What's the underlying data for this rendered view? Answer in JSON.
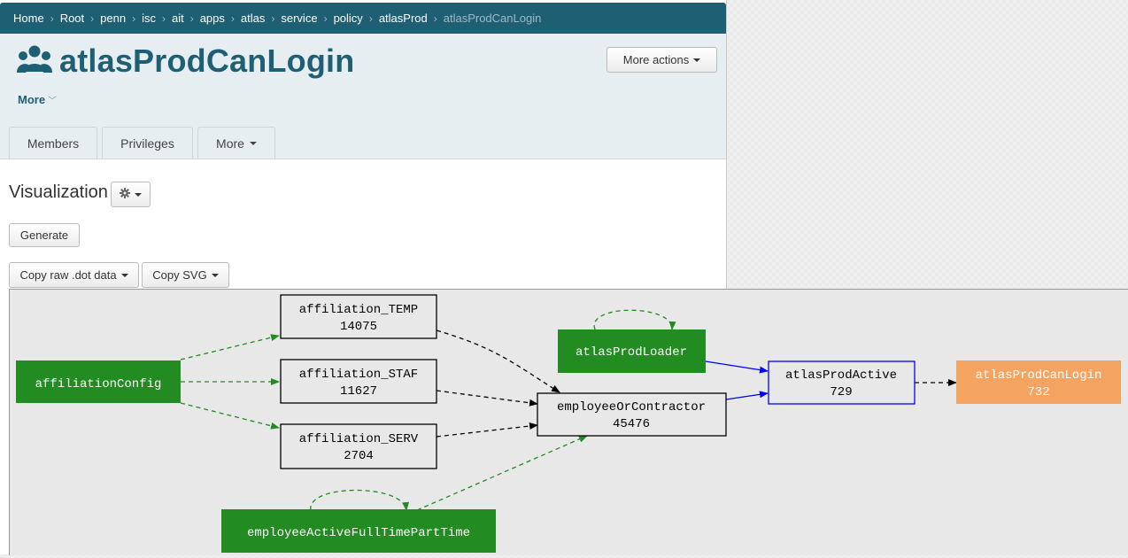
{
  "breadcrumb": [
    "Home",
    "Root",
    "penn",
    "isc",
    "ait",
    "apps",
    "atlas",
    "service",
    "policy",
    "atlasProd",
    "atlasProdCanLogin"
  ],
  "header": {
    "title": "atlasProdCanLogin",
    "more_label": "More",
    "more_actions_label": "More actions"
  },
  "tabs": [
    "Members",
    "Privileges",
    "More"
  ],
  "visualization": {
    "heading": "Visualization",
    "generate_label": "Generate",
    "copy_dot_label": "Copy raw .dot data",
    "copy_svg_label": "Copy SVG"
  },
  "graph": {
    "nodes": [
      {
        "id": "affiliationConfig",
        "label": "affiliationConfig",
        "count": "",
        "style": "green"
      },
      {
        "id": "affiliation_TEMP",
        "label": "affiliation_TEMP",
        "count": "14075",
        "style": "plain"
      },
      {
        "id": "affiliation_STAF",
        "label": "affiliation_STAF",
        "count": "11627",
        "style": "plain"
      },
      {
        "id": "affiliation_SERV",
        "label": "affiliation_SERV",
        "count": "2704",
        "style": "plain"
      },
      {
        "id": "employeeActiveFullTimePartTime",
        "label": "employeeActiveFullTimePartTime",
        "count": "",
        "style": "green"
      },
      {
        "id": "employeeOrContractor",
        "label": "employeeOrContractor",
        "count": "45476",
        "style": "plain"
      },
      {
        "id": "atlasProdLoader",
        "label": "atlasProdLoader",
        "count": "",
        "style": "green"
      },
      {
        "id": "atlasProdActive",
        "label": "atlasProdActive",
        "count": "729",
        "style": "blue"
      },
      {
        "id": "atlasProdCanLogin",
        "label": "atlasProdCanLogin",
        "count": "732",
        "style": "orange"
      }
    ],
    "colors": {
      "green": "#228b22",
      "orange": "#f4a460",
      "blue": "#0000ff",
      "edge_dark": "#000000"
    }
  }
}
